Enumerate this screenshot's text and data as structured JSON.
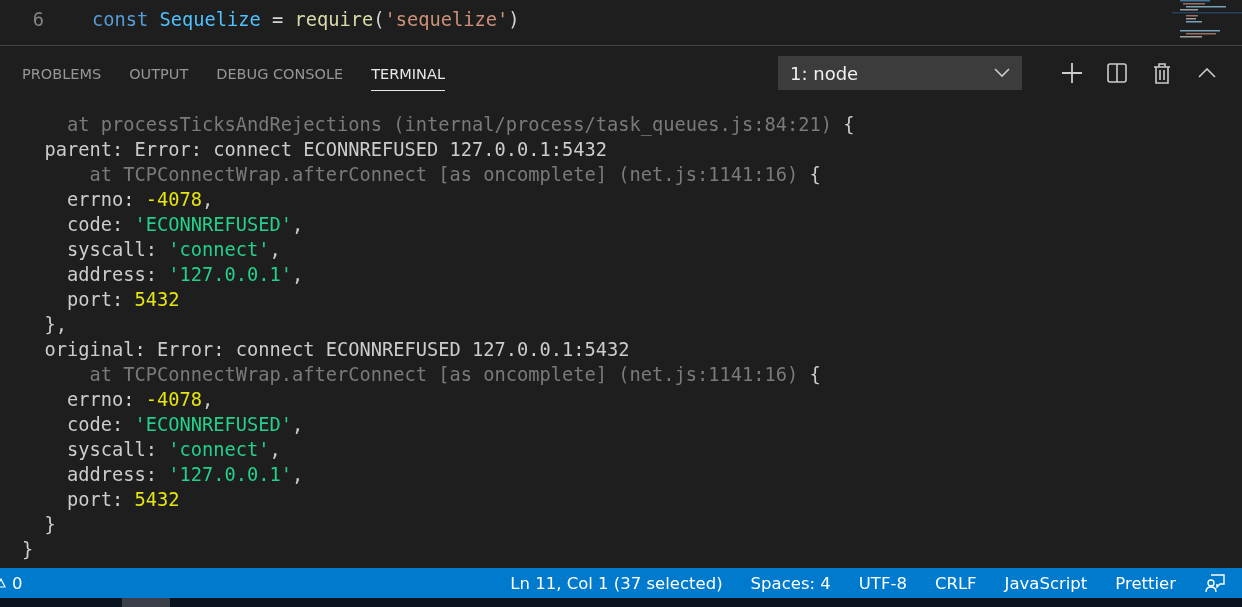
{
  "editor": {
    "lines": [
      {
        "number": "6",
        "tokens": [
          {
            "kind": "keyword",
            "text": "const "
          },
          {
            "kind": "class",
            "text": "Sequelize"
          },
          {
            "kind": "plain",
            "text": " = "
          },
          {
            "kind": "function",
            "text": "require"
          },
          {
            "kind": "plain",
            "text": "("
          },
          {
            "kind": "string",
            "text": "'sequelize'"
          },
          {
            "kind": "plain",
            "text": ")"
          }
        ]
      }
    ]
  },
  "panel": {
    "tabs": [
      {
        "label": "PROBLEMS",
        "selected": false
      },
      {
        "label": "OUTPUT",
        "selected": false
      },
      {
        "label": "DEBUG CONSOLE",
        "selected": false
      },
      {
        "label": "TERMINAL",
        "selected": true
      }
    ],
    "terminal_select": {
      "value": "1: node"
    }
  },
  "terminal": {
    "lines": [
      [
        {
          "kind": "dim",
          "text": "    at processTicksAndRejections (internal/process/task_queues.js:84:21) "
        },
        {
          "kind": "plain",
          "text": "{"
        }
      ],
      [
        {
          "kind": "plain",
          "text": "  parent: Error: connect ECONNREFUSED 127.0.0.1:5432"
        }
      ],
      [
        {
          "kind": "dim",
          "text": "      at TCPConnectWrap.afterConnect [as oncomplete] (net.js:1141:16) "
        },
        {
          "kind": "plain",
          "text": "{"
        }
      ],
      [
        {
          "kind": "plain",
          "text": "    errno: "
        },
        {
          "kind": "number",
          "text": "-4078"
        },
        {
          "kind": "plain",
          "text": ","
        }
      ],
      [
        {
          "kind": "plain",
          "text": "    code: "
        },
        {
          "kind": "string",
          "text": "'ECONNREFUSED'"
        },
        {
          "kind": "plain",
          "text": ","
        }
      ],
      [
        {
          "kind": "plain",
          "text": "    syscall: "
        },
        {
          "kind": "string",
          "text": "'connect'"
        },
        {
          "kind": "plain",
          "text": ","
        }
      ],
      [
        {
          "kind": "plain",
          "text": "    address: "
        },
        {
          "kind": "string",
          "text": "'127.0.0.1'"
        },
        {
          "kind": "plain",
          "text": ","
        }
      ],
      [
        {
          "kind": "plain",
          "text": "    port: "
        },
        {
          "kind": "number",
          "text": "5432"
        }
      ],
      [
        {
          "kind": "plain",
          "text": "  },"
        }
      ],
      [
        {
          "kind": "plain",
          "text": "  original: Error: connect ECONNREFUSED 127.0.0.1:5432"
        }
      ],
      [
        {
          "kind": "dim",
          "text": "      at TCPConnectWrap.afterConnect [as oncomplete] (net.js:1141:16) "
        },
        {
          "kind": "plain",
          "text": "{"
        }
      ],
      [
        {
          "kind": "plain",
          "text": "    errno: "
        },
        {
          "kind": "number",
          "text": "-4078"
        },
        {
          "kind": "plain",
          "text": ","
        }
      ],
      [
        {
          "kind": "plain",
          "text": "    code: "
        },
        {
          "kind": "string",
          "text": "'ECONNREFUSED'"
        },
        {
          "kind": "plain",
          "text": ","
        }
      ],
      [
        {
          "kind": "plain",
          "text": "    syscall: "
        },
        {
          "kind": "string",
          "text": "'connect'"
        },
        {
          "kind": "plain",
          "text": ","
        }
      ],
      [
        {
          "kind": "plain",
          "text": "    address: "
        },
        {
          "kind": "string",
          "text": "'127.0.0.1'"
        },
        {
          "kind": "plain",
          "text": ","
        }
      ],
      [
        {
          "kind": "plain",
          "text": "    port: "
        },
        {
          "kind": "number",
          "text": "5432"
        }
      ],
      [
        {
          "kind": "plain",
          "text": "  }"
        }
      ],
      [
        {
          "kind": "plain",
          "text": "}"
        }
      ]
    ]
  },
  "status_bar": {
    "left": [
      {
        "text": "0"
      }
    ],
    "right": [
      "Ln 11, Col 1 (37 selected)",
      "Spaces: 4",
      "UTF-8",
      "CRLF",
      "JavaScript",
      "Prettier"
    ]
  }
}
